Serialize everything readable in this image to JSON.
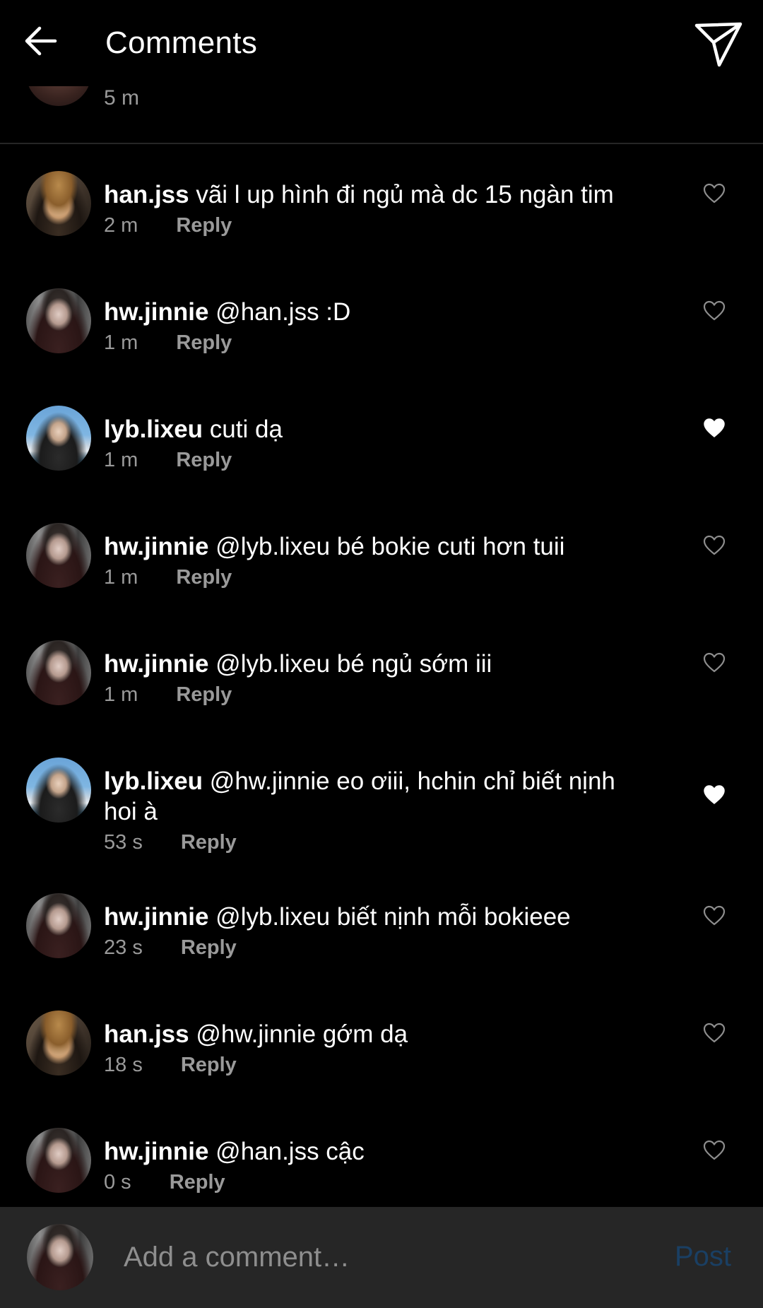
{
  "header": {
    "title": "Comments",
    "back_icon": "arrow-left-icon",
    "send_icon": "paper-plane-icon"
  },
  "partial_comment": {
    "time": "5 m"
  },
  "reply_label": "Reply",
  "comments": [
    {
      "username": "han.jss",
      "text": " vãi l up hình đi ngủ mà dc 15 ngàn tim",
      "time": "2 m",
      "liked": false,
      "avatar": "han.jss"
    },
    {
      "username": "hw.jinnie",
      "text": " @han.jss :D",
      "time": "1 m",
      "liked": false,
      "avatar": "hw.jinnie"
    },
    {
      "username": "lyb.lixeu",
      "text": " cuti dạ",
      "time": "1 m",
      "liked": true,
      "avatar": "lyb.lixeu"
    },
    {
      "username": "hw.jinnie",
      "text": " @lyb.lixeu bé bokie cuti hơn tuii",
      "time": "1 m",
      "liked": false,
      "avatar": "hw.jinnie"
    },
    {
      "username": "hw.jinnie",
      "text": " @lyb.lixeu bé ngủ sớm iii",
      "time": "1 m",
      "liked": false,
      "avatar": "hw.jinnie"
    },
    {
      "username": "lyb.lixeu",
      "text": " @hw.jinnie eo ơiii, hchin chỉ biết nịnh hoi à",
      "time": "53 s",
      "liked": true,
      "avatar": "lyb.lixeu"
    },
    {
      "username": "hw.jinnie",
      "text": " @lyb.lixeu biết nịnh mỗi bokieee",
      "time": "23 s",
      "liked": false,
      "avatar": "hw.jinnie"
    },
    {
      "username": "han.jss",
      "text": " @hw.jinnie gớm dạ",
      "time": "18 s",
      "liked": false,
      "avatar": "han.jss"
    },
    {
      "username": "hw.jinnie",
      "text": " @han.jss cậc",
      "time": "0 s",
      "liked": false,
      "avatar": "hw.jinnie"
    }
  ],
  "composer": {
    "placeholder": "Add a comment…",
    "post_label": "Post"
  },
  "colors": {
    "background": "#000000",
    "composer_bg": "#262626",
    "muted_text": "#9a9a9a",
    "post_disabled": "#1a3f63"
  }
}
